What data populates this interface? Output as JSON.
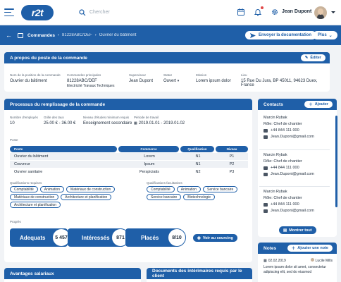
{
  "header": {
    "logo": "r2t",
    "search_placeholder": "Chercher",
    "user_name": "Jean Dupont"
  },
  "subbar": {
    "breadcrumb_1": "Commandes",
    "breadcrumb_2": "81228ABC/DEF",
    "breadcrumb_3": "Ouvrier du bâtiment",
    "send_doc_label": "Envoyer la documentation",
    "more_label": "Plus"
  },
  "about": {
    "title": "A propos du poste de la commande",
    "edit_label": "Éditer",
    "fields": [
      {
        "label": "Nom de la position de la commande",
        "value": "Ouvrier du bâtiment",
        "sub": ""
      },
      {
        "label": "Commandes principales",
        "value": "81228ABC/DEF",
        "sub": "Electricité Travaux Techniques"
      },
      {
        "label": "Superviseur",
        "value": "Jean Dupont",
        "sub": ""
      },
      {
        "label": "Statut",
        "value": "Ouvert",
        "sub": ""
      },
      {
        "label": "Mission",
        "value": "Lorem ipsum dolor",
        "sub": ""
      },
      {
        "label": "Lieu",
        "value": "15 Rue Du Jura, BP 45011, 94623 Duex, France",
        "sub": ""
      }
    ]
  },
  "process": {
    "title": "Processus du remplissage de la commande",
    "fields": [
      {
        "label": "Nombre d'employés",
        "value": "10"
      },
      {
        "label": "Grille des taux",
        "value": "25.00 € - 36.00 €"
      },
      {
        "label": "Niveau d'études minimum requis",
        "value": "Enseignement secondaire"
      },
      {
        "label": "Période de travail",
        "value": "2019.01.01 - 2019.01.02"
      }
    ],
    "posts_label": "Poste",
    "table_headers": [
      "Poste",
      "Commerce",
      "Qualification",
      "Niveau"
    ],
    "table_rows": [
      [
        "Ouvrier du bâtiment",
        "Lorem",
        "N1",
        "P1"
      ],
      [
        "Couvreur",
        "Ipsum",
        "N1",
        "P2"
      ],
      [
        "Ouvrier sanitaire",
        "Perspiciatis",
        "N2",
        "P3"
      ]
    ],
    "required_label": "Qualifications requises",
    "required": [
      "Comptabilité",
      "Animation",
      "Matériaux de construction",
      "Matériaux de construction",
      "Architecture et planification",
      "Architecture et planification"
    ],
    "optional_label": "Qualifications facultatives",
    "optional": [
      "Comptabilité",
      "Animation",
      "Service bancaire",
      "Service bancaire",
      "Biotechnologie"
    ],
    "progress_label": "Progrès",
    "progress": [
      {
        "label": "Adequats",
        "count": "5 457"
      },
      {
        "label": "Intéressés",
        "count": "871"
      },
      {
        "label": "Placés",
        "count": "8/10"
      }
    ],
    "sourcing_label": "Voir au sourcing"
  },
  "advantages_title": "Avantages salariaux",
  "documents_title": "Documents des intérimaires requis par le client",
  "contacts": {
    "title": "Contacts",
    "add_label": "Ajouter",
    "items": [
      {
        "name": "Marcin Rybak",
        "role": "Rôle: Chef de chantier",
        "phone": "+44 844 111 000",
        "email": "Jean.Dupont@gmail.com"
      },
      {
        "name": "Marcin Rybak",
        "role": "Rôle: Chef de chantier",
        "phone": "+44 844 111 000",
        "email": "Jean.Dupont@gmail.com"
      },
      {
        "name": "Marcin Rybak",
        "role": "Rôle: Chef de chantier",
        "phone": "+44 844 111 000",
        "email": "Jean.Dupont@gmail.com"
      }
    ],
    "show_all_label": "Montrer tout"
  },
  "notes": {
    "title": "Notes",
    "add_label": "Ajouter une note",
    "date": "02.02.2019",
    "author": "Lucile Mills",
    "text": "Lorem ipsum dolor sit amet, consectetur adipiscing elit, sed do eiusmod"
  }
}
